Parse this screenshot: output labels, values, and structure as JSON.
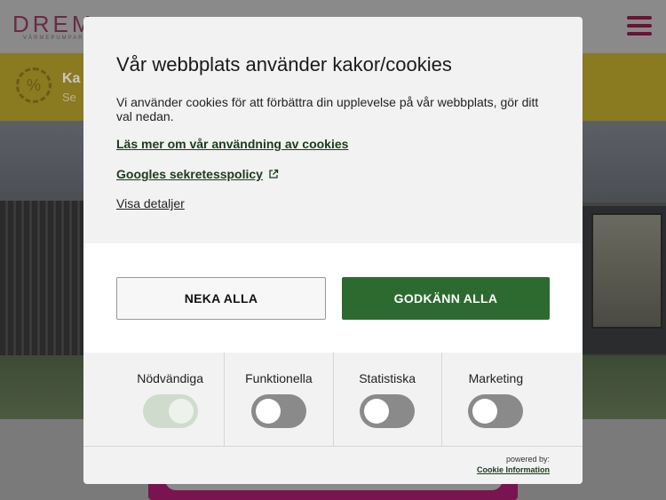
{
  "background": {
    "logo_text": "DREM",
    "logo_sub": "VÄRMEPUMPAR",
    "banner_title": "Ka",
    "banner_sub": "Se",
    "badge_symbol": "%"
  },
  "modal": {
    "title": "Vår webbplats använder kakor/cookies",
    "description": "Vi använder cookies för att förbättra din upplevelse på vår webbplats, gör ditt val nedan.",
    "link_cookies": "Läs mer om vår användning av cookies",
    "link_google": "Googles sekretesspolicy",
    "link_details": "Visa detaljer",
    "btn_deny": "NEKA ALLA",
    "btn_accept": "GODKÄNN ALLA",
    "toggles": [
      {
        "label": "Nödvändiga",
        "on": true,
        "locked": true
      },
      {
        "label": "Funktionella",
        "on": false
      },
      {
        "label": "Statistiska",
        "on": false
      },
      {
        "label": "Marketing",
        "on": false
      }
    ],
    "powered_by": "powered by:",
    "powered_link": "Cookie Information"
  },
  "colors": {
    "accent_green": "#2d6a2f",
    "link_green": "#1c3a1c",
    "brand": "#6b1236"
  }
}
